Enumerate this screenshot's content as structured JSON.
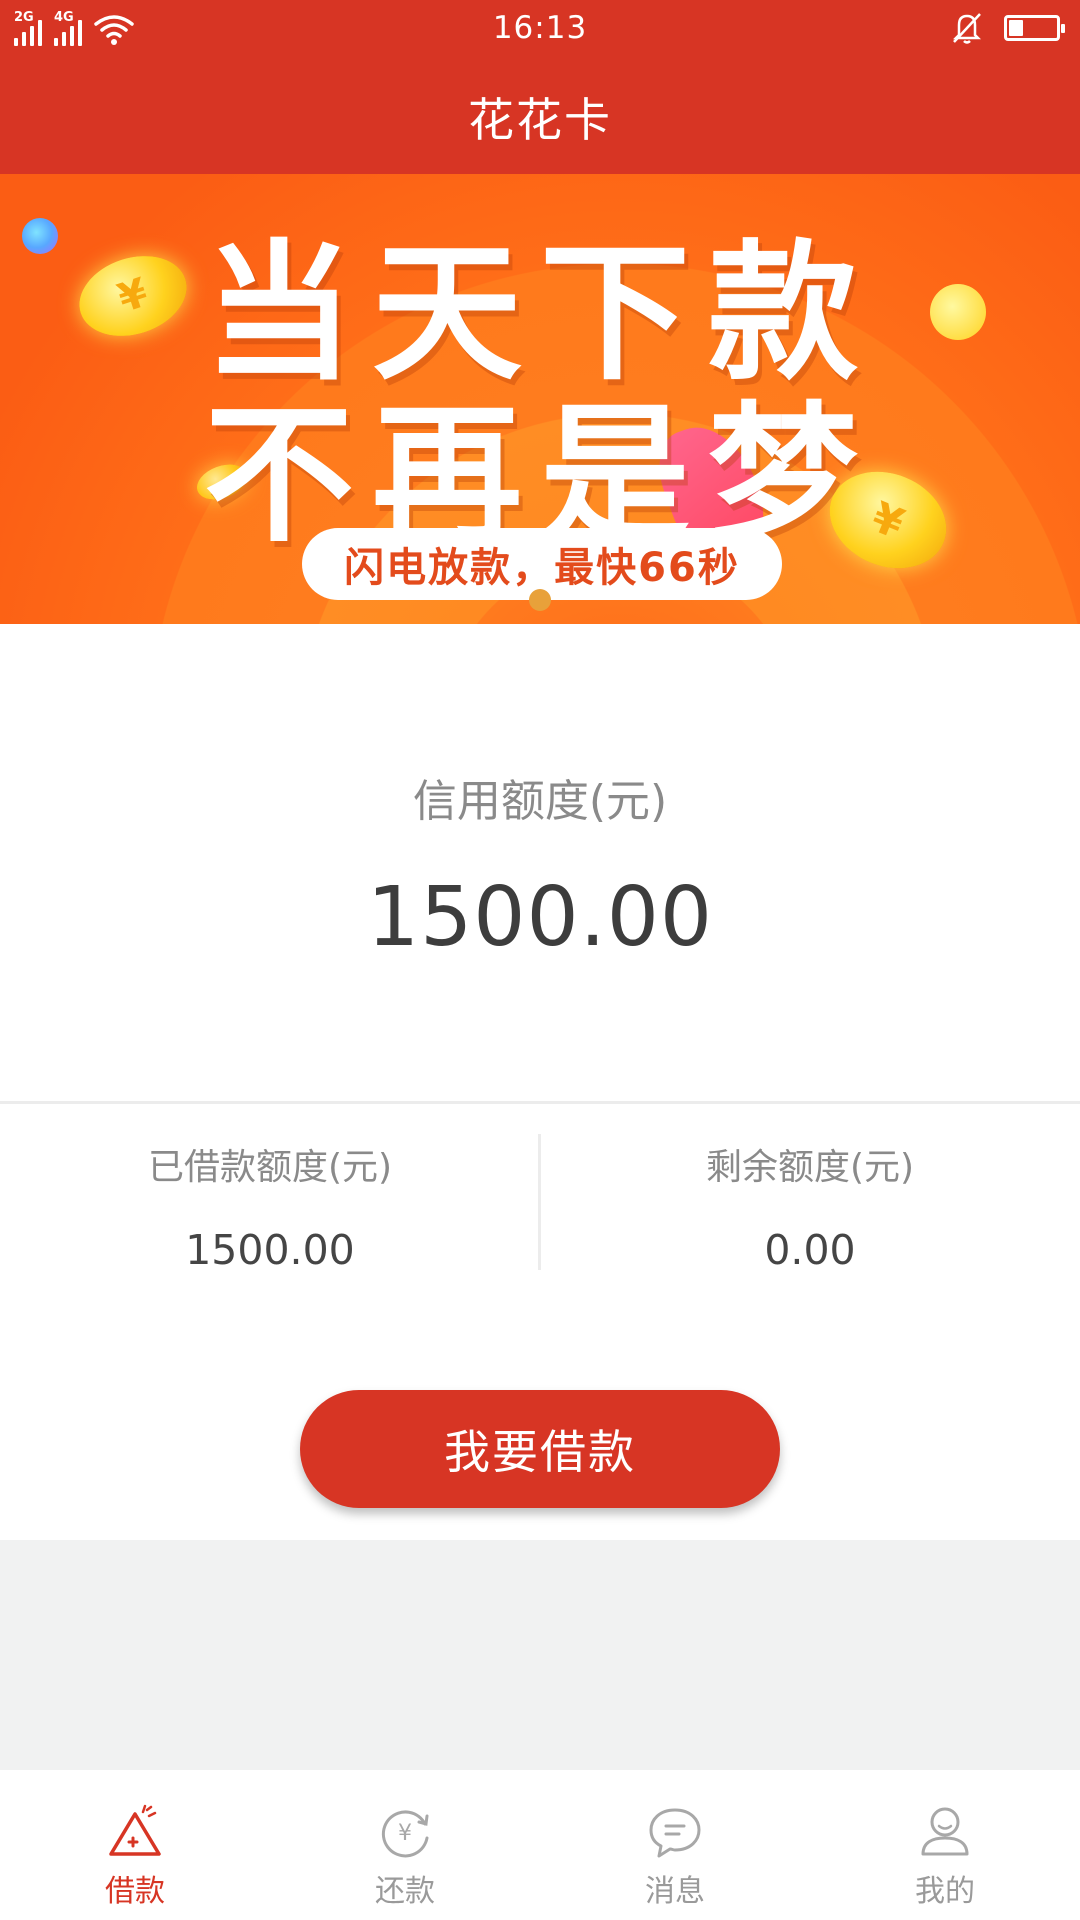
{
  "status_bar": {
    "network1": "2G",
    "network2": "4G",
    "time": "16:13",
    "battery_level": 0.3
  },
  "header": {
    "title": "花花卡"
  },
  "banner": {
    "line1": "当天下款",
    "line2": "不再是梦",
    "tagline": "闪电放款，最快66秒",
    "coin_symbol": "¥"
  },
  "credit": {
    "label": "信用额度(元)",
    "value": "1500.00"
  },
  "stats": {
    "borrowed_label": "已借款额度(元)",
    "borrowed_value": "1500.00",
    "remaining_label": "剩余额度(元)",
    "remaining_value": "0.00"
  },
  "borrow_button": {
    "label": "我要借款"
  },
  "tabs": [
    {
      "label": "借款",
      "icon": "loan-icon",
      "active": true
    },
    {
      "label": "还款",
      "icon": "repay-icon",
      "active": false
    },
    {
      "label": "消息",
      "icon": "message-icon",
      "active": false
    },
    {
      "label": "我的",
      "icon": "profile-icon",
      "active": false
    }
  ],
  "colors": {
    "primary": "#d73524",
    "banner_orange": "#ff7a1e",
    "inactive_tab": "#9a9a9a",
    "gray_background": "#f1f2f2"
  }
}
